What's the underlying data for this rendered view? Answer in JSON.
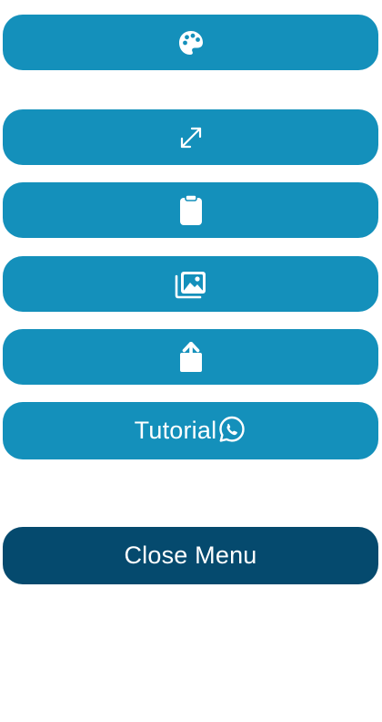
{
  "menu": {
    "buttons": [
      {
        "id": "theme",
        "icon": "palette-icon"
      },
      {
        "id": "fullscreen",
        "icon": "expand-arrows-icon"
      },
      {
        "id": "clipboard",
        "icon": "clipboard-icon"
      },
      {
        "id": "gallery",
        "icon": "images-icon"
      },
      {
        "id": "share",
        "icon": "share-upload-icon"
      }
    ],
    "tutorial_label": "Tutorial",
    "tutorial_icon": "whatsapp-icon",
    "close_label": "Close Menu"
  },
  "colors": {
    "button_bg": "#1490bb",
    "close_bg": "#054a6e",
    "text": "#ffffff"
  }
}
